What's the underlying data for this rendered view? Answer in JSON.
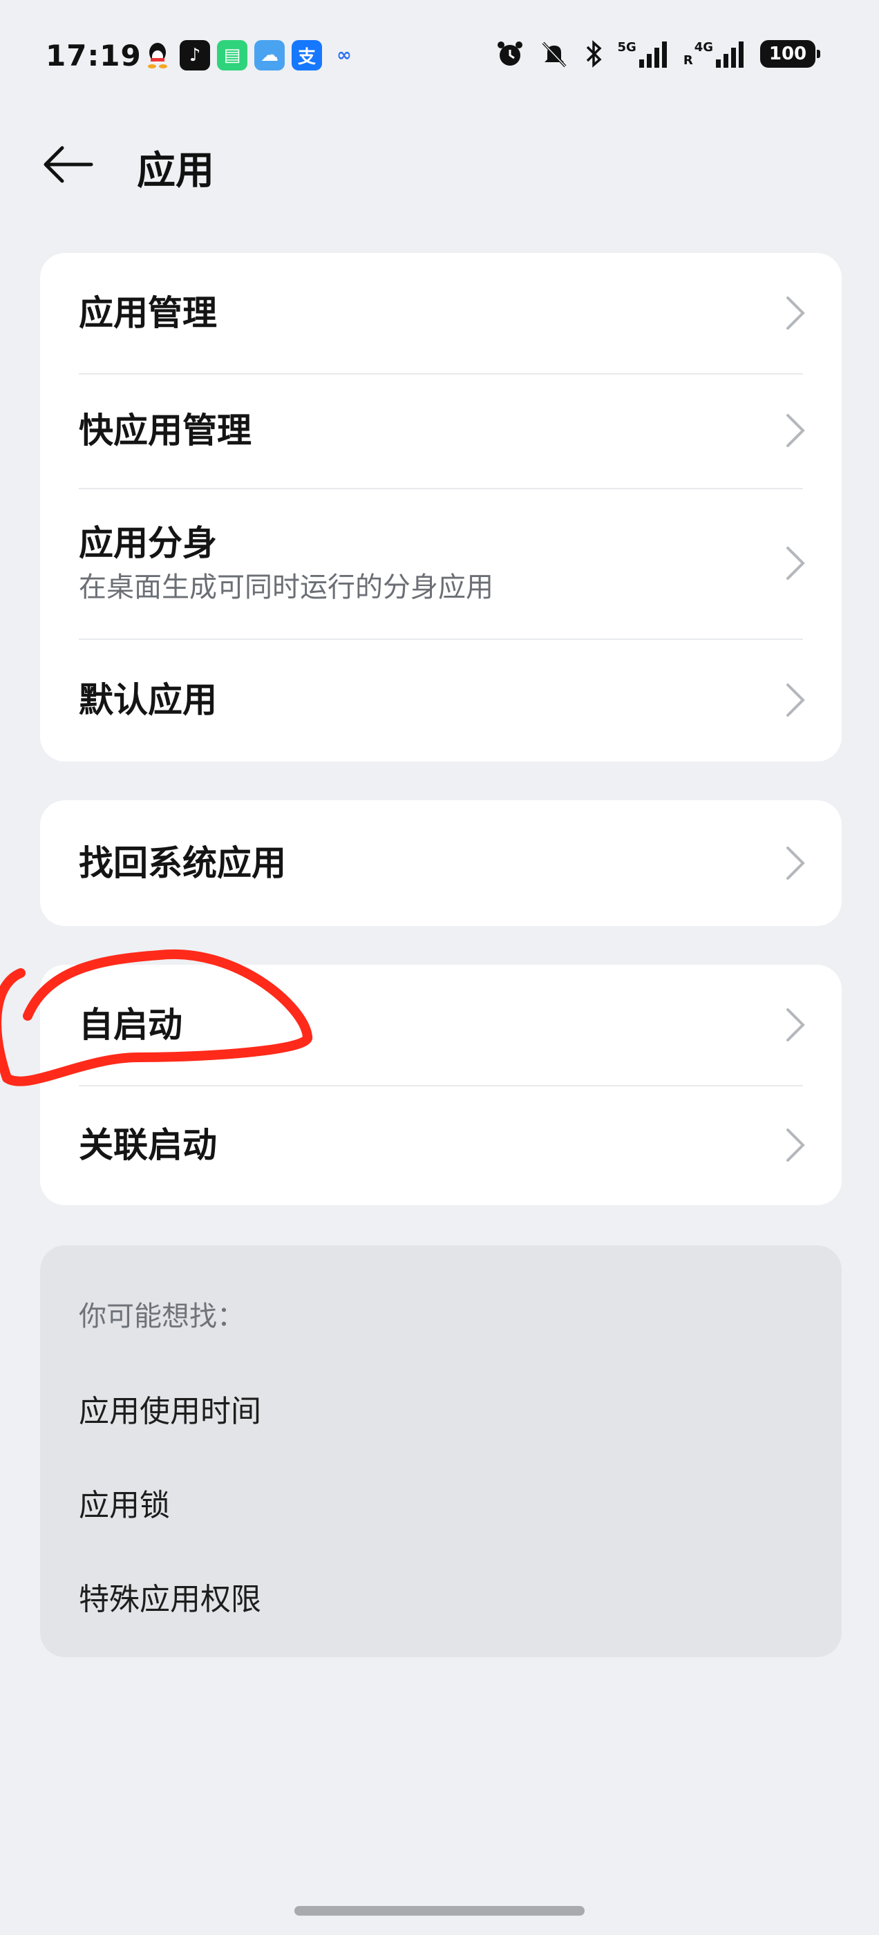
{
  "status_bar": {
    "time": "17:19",
    "network_5g_label": "5G",
    "network_4g_label": "4G",
    "roaming_label": "R",
    "battery_level": "100",
    "notification_icons": [
      "qq-icon",
      "douyin-icon",
      "green-app-icon",
      "weather-icon",
      "alipay-icon",
      "baidu-cloud-icon"
    ],
    "system_icons": [
      "alarm-icon",
      "mute-icon",
      "bluetooth-icon",
      "signal-5g-icon",
      "signal-4g-icon",
      "battery-icon"
    ]
  },
  "header": {
    "title": "应用"
  },
  "group1": {
    "items": [
      {
        "label": "应用管理"
      },
      {
        "label": "快应用管理"
      },
      {
        "label": "应用分身",
        "sublabel": "在桌面生成可同时运行的分身应用"
      },
      {
        "label": "默认应用"
      }
    ]
  },
  "group2": {
    "items": [
      {
        "label": "找回系统应用"
      }
    ]
  },
  "group3": {
    "items": [
      {
        "label": "自启动"
      },
      {
        "label": "关联启动"
      }
    ]
  },
  "suggestions": {
    "title": "你可能想找：",
    "items": [
      "应用使用时间",
      "应用锁",
      "特殊应用权限"
    ]
  },
  "colors": {
    "background": "#eef0f3",
    "card": "#ffffff",
    "suggest_bg": "#e3e4e7",
    "annotation_red": "#ff2a1a"
  }
}
